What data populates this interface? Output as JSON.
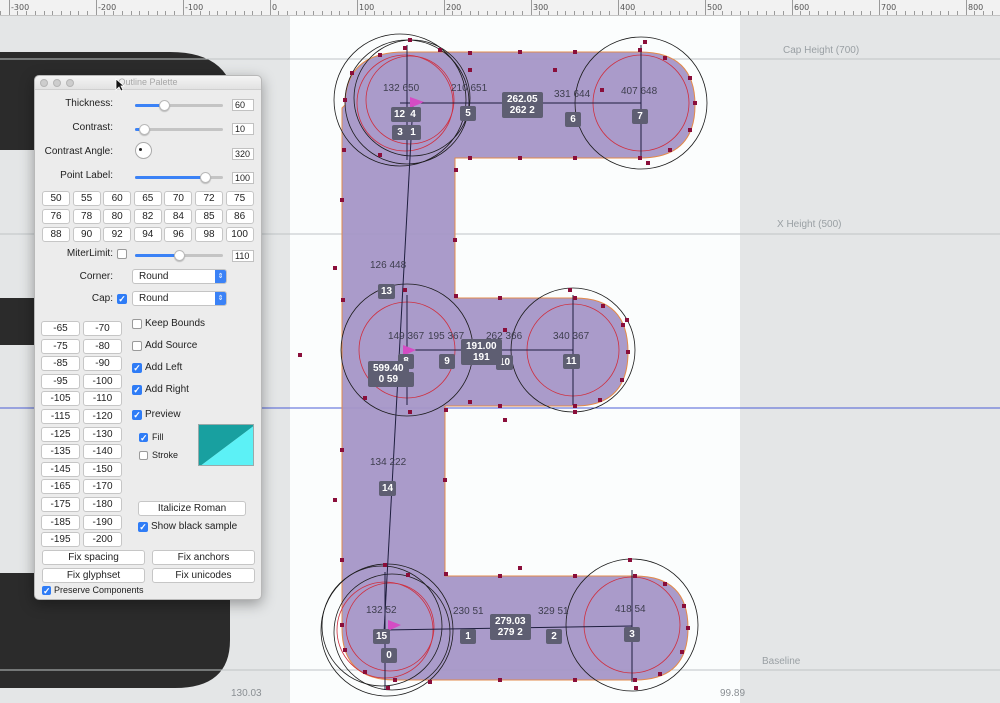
{
  "ruler": {
    "labels": [
      "-300",
      "-200",
      "-100",
      "0",
      "100",
      "200",
      "300",
      "400",
      "500",
      "600",
      "700",
      "800"
    ]
  },
  "metrics": {
    "cap_height": "Cap Height (700)",
    "x_height": "X Height (500)",
    "baseline": "Baseline"
  },
  "sidebearings": {
    "left": "130.03",
    "right": "99.89"
  },
  "glyph": {
    "point_labels": [
      "132 650",
      "210 651",
      "331 644",
      "407 648",
      "126 448",
      "149 367",
      "195 367",
      "262 366",
      "340 367",
      "134 222",
      "132 52",
      "230 51",
      "329 51",
      "418 54"
    ],
    "node_numbers": [
      "12",
      "4",
      "3",
      "1",
      "5",
      "6",
      "7",
      "13",
      "8",
      "2",
      "9",
      "10",
      "11",
      "14",
      "15",
      "0",
      "1",
      "2",
      "3"
    ],
    "width_badges": [
      {
        "top": "262.05",
        "bottom": "262  2"
      },
      {
        "top": "191.00",
        "bottom": "191"
      },
      {
        "top": "599.40",
        "bottom": "0  59"
      },
      {
        "top": "279.03",
        "bottom": "279  2"
      }
    ],
    "colors": {
      "fill": "#a596c7",
      "outline": "#e38a4a",
      "node": "#8a0e3a",
      "accent": "#3b3bd6"
    }
  },
  "palette": {
    "title": "Outline Palette",
    "thickness": {
      "label": "Thickness:",
      "value": "60",
      "percent": 0.33
    },
    "contrast": {
      "label": "Contrast:",
      "value": "10",
      "percent": 0.1
    },
    "contrast_angle": {
      "label": "Contrast Angle:",
      "value": "320"
    },
    "point_label": {
      "label": "Point Label:",
      "value": "100",
      "percent": 0.8
    },
    "presets": [
      "50",
      "55",
      "60",
      "65",
      "70",
      "72",
      "75",
      "76",
      "78",
      "80",
      "82",
      "84",
      "85",
      "86",
      "88",
      "90",
      "92",
      "94",
      "96",
      "98",
      "100"
    ],
    "miter": {
      "label": "MiterLimit:",
      "value": "110",
      "percent": 0.5
    },
    "corner": {
      "label": "Corner:",
      "value": "Round"
    },
    "cap": {
      "label": "Cap:",
      "value": "Round",
      "checked": true
    },
    "offsets": [
      "-65",
      "-70",
      "-75",
      "-80",
      "-85",
      "-90",
      "-95",
      "-100",
      "-105",
      "-110",
      "-115",
      "-120",
      "-125",
      "-130",
      "-135",
      "-140",
      "-145",
      "-150",
      "-165",
      "-170",
      "-175",
      "-180",
      "-185",
      "-190",
      "-195",
      "-200"
    ],
    "options": [
      {
        "label": "Keep Bounds",
        "checked": false
      },
      {
        "label": "Add Source",
        "checked": false
      },
      {
        "label": "Add Left",
        "checked": true
      },
      {
        "label": "Add Right",
        "checked": true
      },
      {
        "label": "Preview",
        "checked": true
      }
    ],
    "fill": {
      "label": "Fill",
      "checked": true
    },
    "stroke": {
      "label": "Stroke",
      "checked": false
    },
    "italicize": "Italicize Roman",
    "show_black": {
      "label": "Show black sample",
      "checked": true
    },
    "fix_spacing": "Fix spacing",
    "fix_anchors": "Fix anchors",
    "fix_glyphset": "Fix glyphset",
    "fix_unicodes": "Fix unicodes",
    "preserve": {
      "label": "Preserve Components",
      "checked": true
    },
    "swatch_colors": [
      "#18a0a0",
      "#5cf1f6"
    ]
  }
}
